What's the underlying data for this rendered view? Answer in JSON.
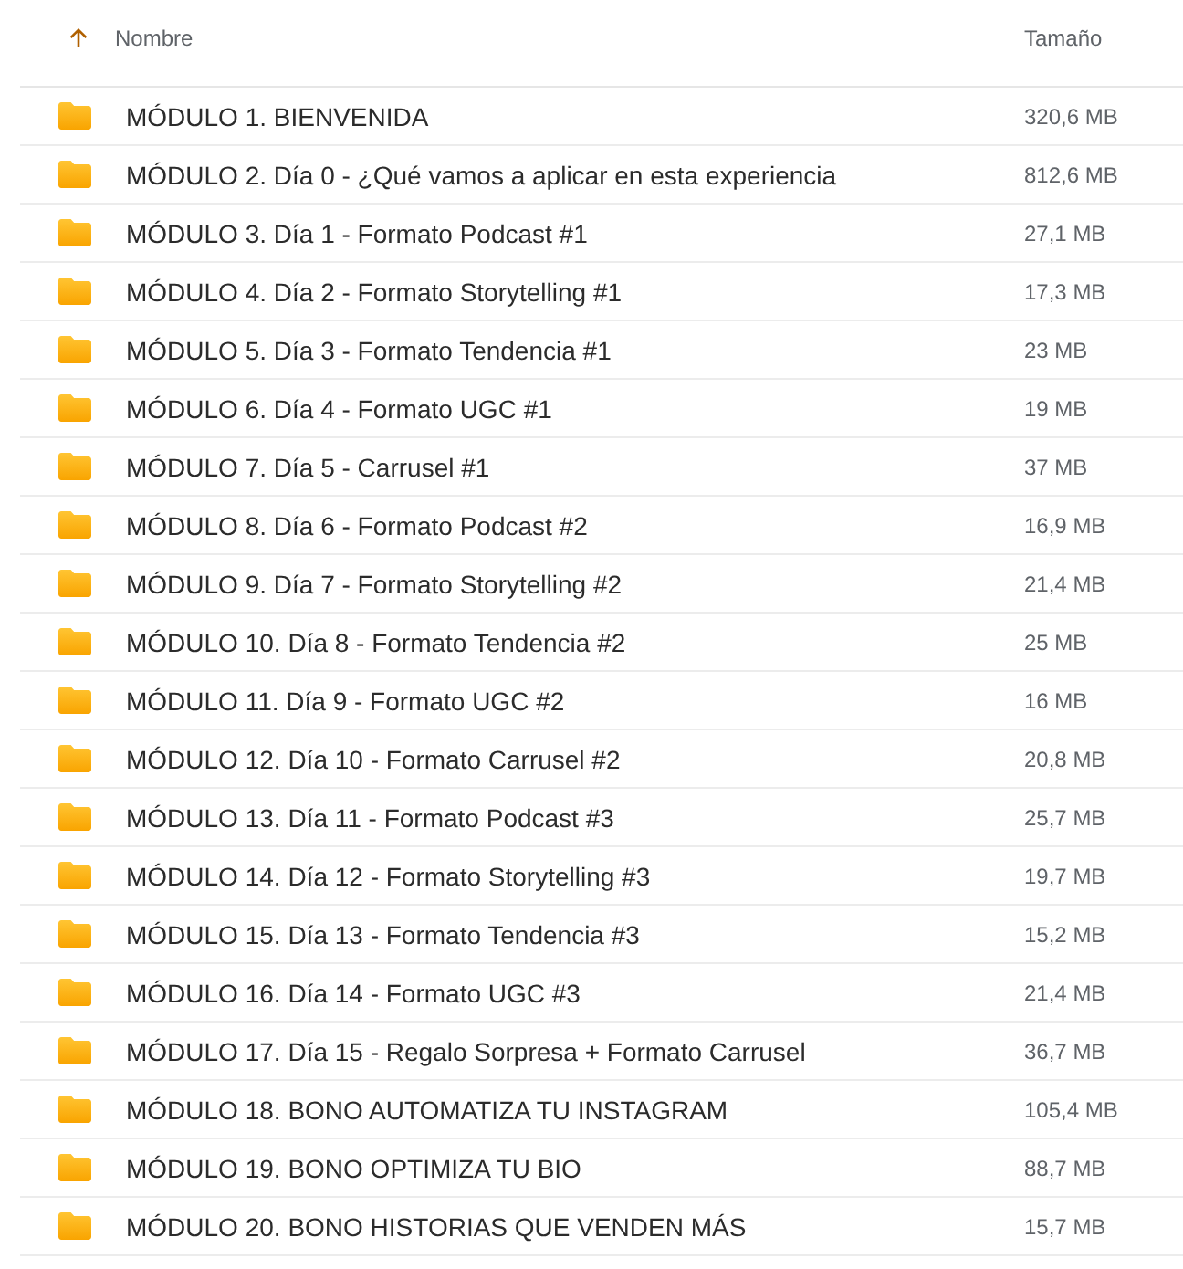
{
  "header": {
    "columns": [
      {
        "label": "Nombre",
        "sorted": true
      },
      {
        "label": "Tamaño",
        "sorted": false
      }
    ]
  },
  "rows": [
    {
      "name": "MÓDULO 1. BIENVENIDA",
      "size": "320,6 MB"
    },
    {
      "name": "MÓDULO 2. Día 0 - ¿Qué vamos a aplicar en esta experiencia",
      "size": "812,6 MB"
    },
    {
      "name": "MÓDULO 3. Día 1 - Formato Podcast #1",
      "size": "27,1 MB"
    },
    {
      "name": "MÓDULO 4. Día 2 - Formato Storytelling #1",
      "size": "17,3 MB"
    },
    {
      "name": "MÓDULO 5. Día 3 - Formato Tendencia #1",
      "size": "23 MB"
    },
    {
      "name": "MÓDULO 6. Día 4 - Formato UGC #1",
      "size": "19 MB"
    },
    {
      "name": "MÓDULO 7. Día 5 - Carrusel #1",
      "size": "37 MB"
    },
    {
      "name": "MÓDULO 8. Día 6 - Formato Podcast #2",
      "size": "16,9 MB"
    },
    {
      "name": "MÓDULO 9. Día 7 - Formato Storytelling #2",
      "size": "21,4 MB"
    },
    {
      "name": "MÓDULO 10. Día 8 - Formato Tendencia #2",
      "size": "25 MB"
    },
    {
      "name": "MÓDULO 11. Día 9 - Formato UGC #2",
      "size": "16 MB"
    },
    {
      "name": "MÓDULO 12. Día 10 - Formato Carrusel #2",
      "size": "20,8 MB"
    },
    {
      "name": "MÓDULO 13. Día 11 - Formato Podcast #3",
      "size": "25,7 MB"
    },
    {
      "name": "MÓDULO 14. Día 12 - Formato Storytelling #3",
      "size": "19,7 MB"
    },
    {
      "name": "MÓDULO 15. Día 13 - Formato Tendencia #3",
      "size": "15,2 MB"
    },
    {
      "name": "MÓDULO 16. Día 14 - Formato UGC #3",
      "size": "21,4 MB"
    },
    {
      "name": "MÓDULO 17. Día 15 - Regalo Sorpresa + Formato Carrusel",
      "size": "36,7 MB"
    },
    {
      "name": "MÓDULO 18. BONO AUTOMATIZA TU INSTAGRAM",
      "size": "105,4 MB"
    },
    {
      "name": "MÓDULO 19. BONO OPTIMIZA TU BIO",
      "size": "88,7 MB"
    },
    {
      "name": "MÓDULO 20. BONO HISTORIAS QUE VENDEN MÁS",
      "size": "15,7 MB"
    }
  ]
}
